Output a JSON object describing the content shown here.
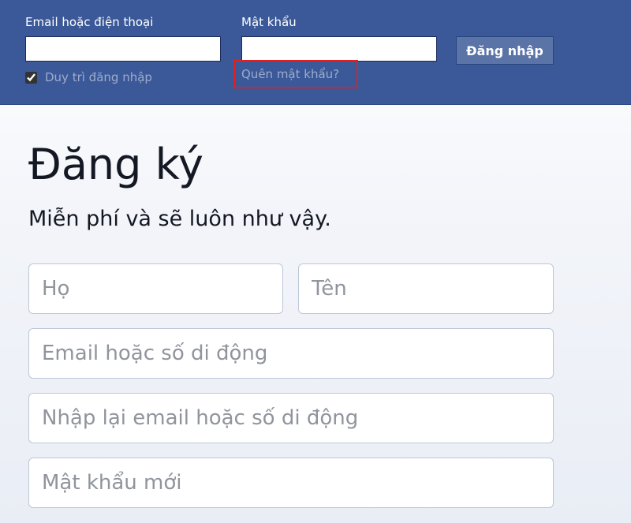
{
  "header": {
    "email_label": "Email hoặc điện thoại",
    "email_value": "",
    "password_label": "Mật khẩu",
    "password_value": "",
    "login_button": "Đăng nhập",
    "keep_logged_in": "Duy trì đăng nhập",
    "keep_logged_in_checked": true,
    "forgot_password": "Quên mật khẩu?"
  },
  "signup": {
    "title": "Đăng ký",
    "subtitle": "Miễn phí và sẽ luôn như vậy.",
    "first_name_placeholder": "Họ",
    "last_name_placeholder": "Tên",
    "email_placeholder": "Email hoặc số di động",
    "email_confirm_placeholder": "Nhập lại email hoặc số di động",
    "new_password_placeholder": "Mật khẩu mới"
  },
  "colors": {
    "brand_blue": "#3b5998",
    "highlight_red": "#e0201f"
  }
}
